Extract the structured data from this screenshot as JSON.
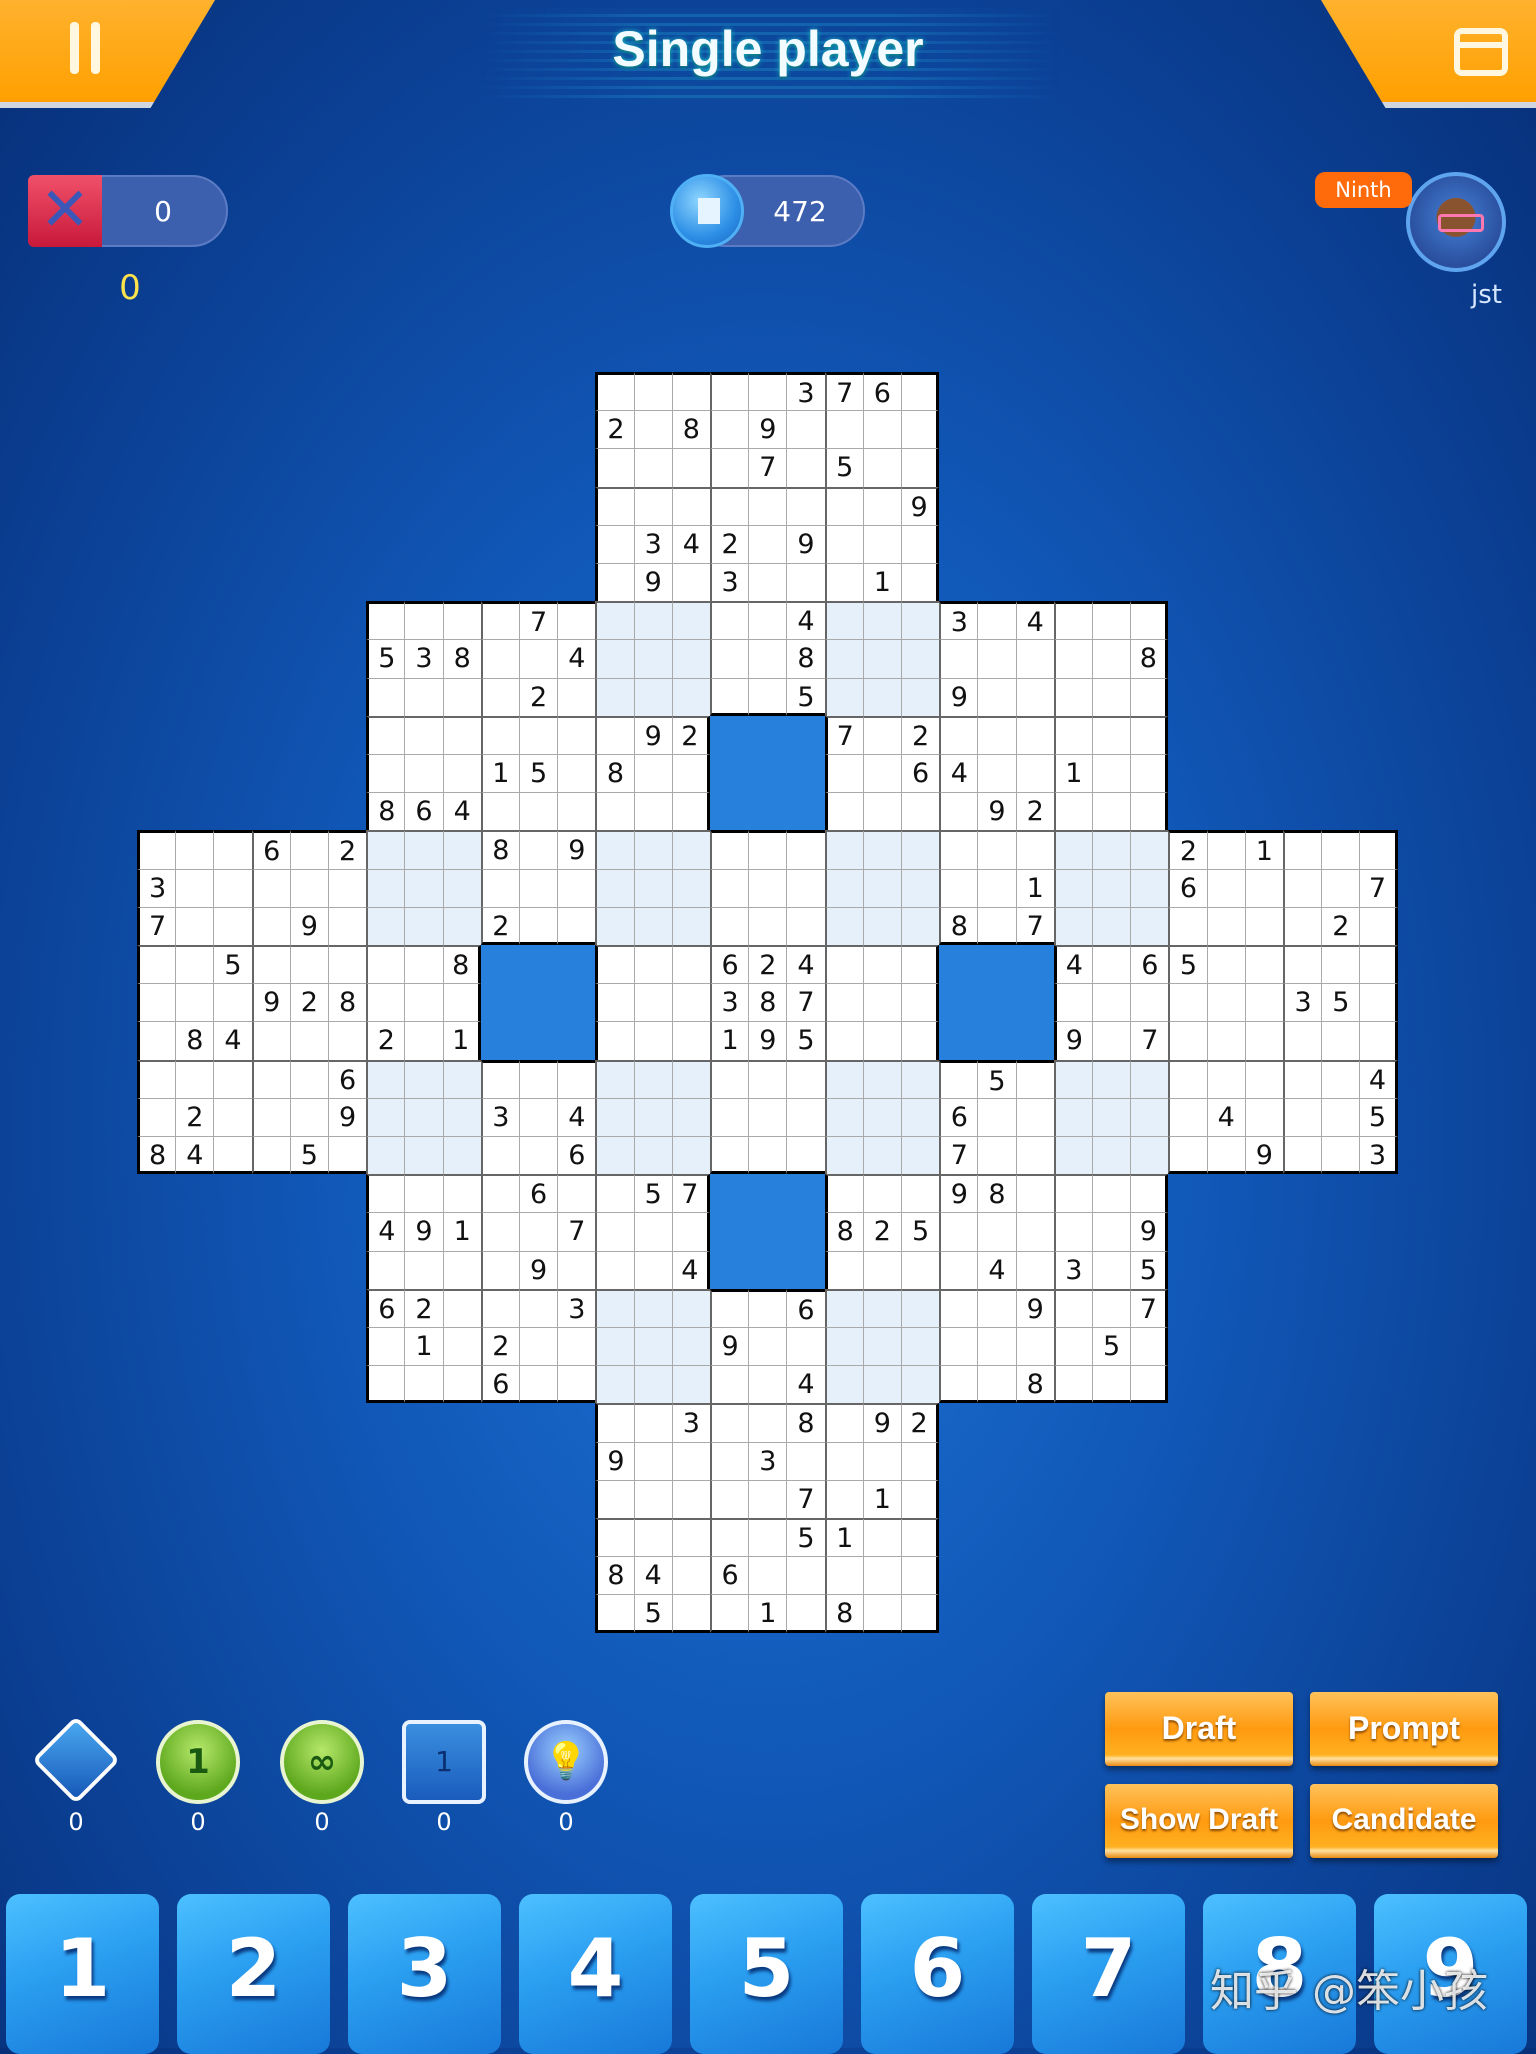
{
  "header": {
    "title": "Single player",
    "pause_icon": "pause-icon",
    "shop_icon": "shop-icon"
  },
  "stats": {
    "mistakes_pill": "0",
    "mistakes_icon": "x-icon",
    "mistakes_symbol": "✕",
    "mistakes_count": "0",
    "coins": "472",
    "coin_icon": "coin-icon"
  },
  "player": {
    "rank": "Ninth",
    "name": "jst"
  },
  "board": {
    "sudoku_origins": [
      [
        0,
        12
      ],
      [
        6,
        6
      ],
      [
        6,
        18
      ],
      [
        12,
        0
      ],
      [
        12,
        12
      ],
      [
        12,
        24
      ],
      [
        18,
        6
      ],
      [
        18,
        18
      ],
      [
        24,
        12
      ]
    ],
    "rows": [
      "...|...|...|...|...|..3|76.|...|...|...|...",
      "...|...|...|...|2.8|.9.|...|...|...|...|...",
      "...|...|...|...|...|.7.|5..|...|...|...|...",
      "...|...|...|...|...|...|..9|...|...|...|...",
      "...|...|...|...|.34|2.9|...|...|...|...|...",
      "...|...|...|...|.9.|3..|.1.|...|...|...|...",
      "...|...|...|.7.|...|..4|...|3.4|...|...|...",
      "...|...|538|..4|...|..8|...|...|..8|...|...",
      "...|...|...|.2.|...|..5|...|9..|...|...|...",
      "...|...|...|...|.92|...|7.2|...|...|...|...",
      "...|...|...|15.|8..|...|..6|4..|1..|...|...",
      "...|...|864|...|...|...|...|.92|...|...|...",
      "...|6.2|...|8.9|...|...|...|...|...|2.1|...",
      "3..|...|...|...|...|...|...|..1|...|6..|..7",
      "7..|.9.|...|2..|...|...|...|8.7|...|...|.2.",
      "..5|...|..8|...|...|624|...|...|4.6|5..|...",
      "...|928|...|...|...|387|...|...|...|...|35.",
      ".84|...|2.1|...|...|195|...|...|9.7|...|...",
      "...|..6|...|...|...|...|...|.5.|...|...|..4",
      ".2.|..9|...|3.4|...|...|...|6..|...|.4.|..5",
      "84.|.5.|...|..6|...|...|...|7..|...|..9|..3",
      "...|...|...|.6.|.57|...|...|98.|...|...|...",
      "...|...|491|..7|...|...|825|...|..9|...|...",
      "...|...|...|.9.|..4|...|...|.4.|3.5|...|...",
      "...|...|62.|..3|...|..6|...|..9|..7|...|...",
      "...|...|.1.|2..|...|9..|...|...|.5.|...|...",
      "...|...|...|6..|...|..4|...|..8|...|...|...",
      "...|...|...|...|..3|..8|.92|...|...|...|...",
      "...|...|...|...|9..|.3.|...|...|...|...|...",
      "...|...|...|...|...|..7|.1.|...|...|...|...",
      "...|...|...|...|...|..5|1..|...|...|...|...",
      "...|...|...|...|84.|6..|...|...|...|...|...",
      "...|...|...|...|.5.|.1.|8..|...|...|...|..."
    ],
    "colors": {
      "cell": "#ffffff",
      "overlap": "#e6f0fa",
      "hole": "#2680dc"
    }
  },
  "tools": [
    {
      "icon": "magnifier-icon",
      "glyph": "",
      "count": "0"
    },
    {
      "icon": "single-one-icon",
      "glyph": "1",
      "count": "0"
    },
    {
      "icon": "infinity-icon",
      "glyph": "∞",
      "count": "0"
    },
    {
      "icon": "grid-cell-icon",
      "glyph": "1",
      "count": "0"
    },
    {
      "icon": "lightbulb-icon",
      "glyph": "💡",
      "count": "0"
    }
  ],
  "actions": {
    "draft": "Draft",
    "prompt": "Prompt",
    "show_draft": "Show Draft",
    "candidate": "Candidate"
  },
  "numpad": [
    "1",
    "2",
    "3",
    "4",
    "5",
    "6",
    "7",
    "8",
    "9"
  ],
  "watermark": "知乎 @笨小孩"
}
